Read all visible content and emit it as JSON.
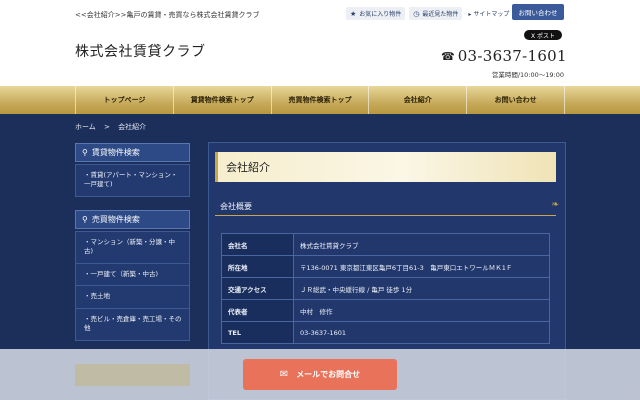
{
  "header": {
    "tagline": "<<会社紹介>>亀戸の賃貸・売買なら株式会社賃貸クラブ",
    "logo": "株式会社賃貸クラブ",
    "favorites_label": "お気に入り物件",
    "recent_label": "最近見た物件",
    "sitemap_label": "サイトマップ",
    "contact_label": "お問い合わせ",
    "xpost_label": "X ポスト",
    "phone": "03-3637-1601",
    "hours": "営業時間/10:00〜19:00"
  },
  "nav": {
    "items": [
      "トップページ",
      "賃貸物件検索トップ",
      "売買物件検索トップ",
      "会社紹介",
      "お問い合わせ"
    ]
  },
  "breadcrumb": {
    "home": "ホーム",
    "sep": ">",
    "current": "会社紹介"
  },
  "sidebar": {
    "rent_head": "賃貸物件検索",
    "rent_items": [
      "賃貸(アパート・マンション・一戸建て)"
    ],
    "sale_head": "売買物件検索",
    "sale_items": [
      "マンション（新築・分譲・中古)",
      "一戸建て（新築・中古)",
      "売土地",
      "売ビル・売倉庫・売工場・その他"
    ]
  },
  "main": {
    "title": "会社紹介",
    "section": "会社概要",
    "rows": [
      {
        "key": "会社名",
        "value": "株式会社賃貸クラブ"
      },
      {
        "key": "所在地",
        "value": "〒136-0071 東京都江東区亀戸6丁目61-3　亀戸東口エトワールＭＫ1Ｆ"
      },
      {
        "key": "交通アクセス",
        "value": "ＪＲ総武・中央緩行線 / 亀戸 徒歩 1分"
      },
      {
        "key": "代表者",
        "value": "中村　修作"
      },
      {
        "key": "TEL",
        "value": "03-3637-1601"
      }
    ]
  },
  "footer": {
    "mail_label": "メールでお問合せ"
  },
  "colors": {
    "page_bg": "#1c2e5a",
    "gold": "#c9a74a",
    "accent_button": "#e8735a",
    "contact_button": "#3a5a9a"
  },
  "icons": [
    "star-icon",
    "clock-icon",
    "phone-icon",
    "search-icon",
    "mail-icon"
  ]
}
